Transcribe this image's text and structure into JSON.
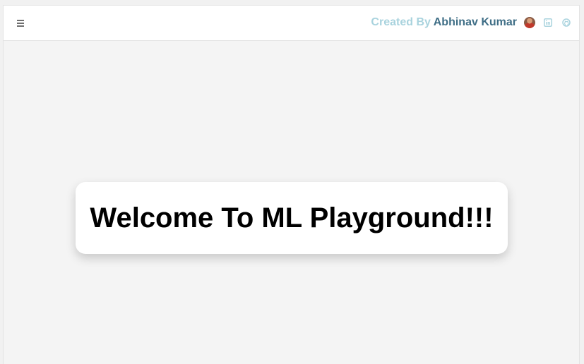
{
  "header": {
    "credit_prefix": "Created By ",
    "credit_name": "Abhinav Kumar",
    "icons": [
      "menu-icon",
      "avatar",
      "linkedin-icon",
      "github-icon"
    ]
  },
  "main": {
    "welcome_title": "Welcome To ML Playground!!!"
  },
  "colors": {
    "credit_prefix": "#a9d3de",
    "credit_name": "#3f6e86",
    "social_icon": "#a9d3de",
    "background": "#f4f4f4"
  }
}
